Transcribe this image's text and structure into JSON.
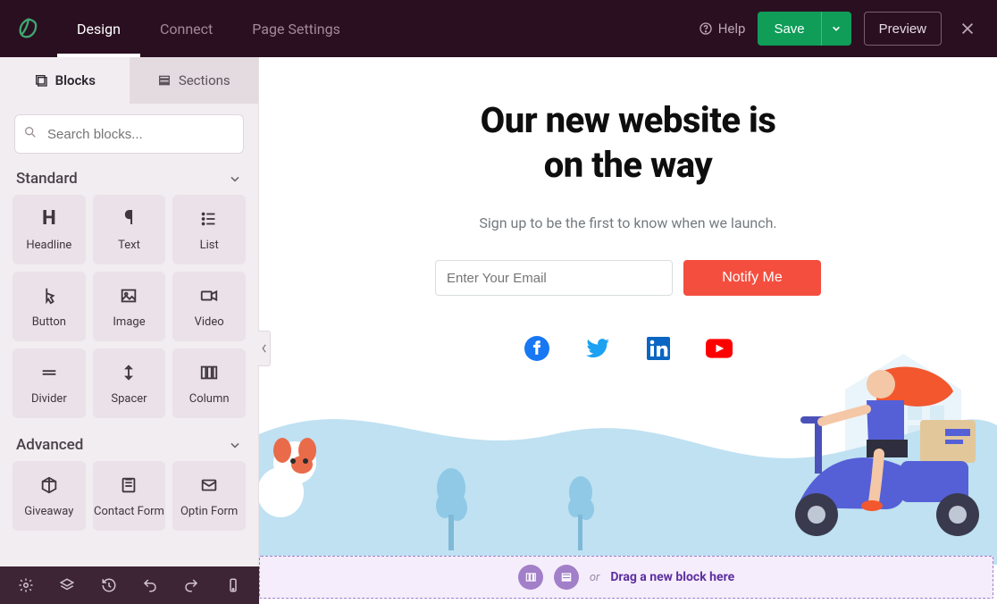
{
  "topbar": {
    "tabs": [
      "Design",
      "Connect",
      "Page Settings"
    ],
    "active_tab": 0,
    "help_label": "Help",
    "save_label": "Save",
    "preview_label": "Preview"
  },
  "sidebar": {
    "tabs": {
      "blocks": "Blocks",
      "sections": "Sections",
      "active": "blocks"
    },
    "search_placeholder": "Search blocks...",
    "groups": [
      {
        "title": "Standard",
        "items": [
          {
            "key": "headline",
            "label": "Headline"
          },
          {
            "key": "text",
            "label": "Text"
          },
          {
            "key": "list",
            "label": "List"
          },
          {
            "key": "button",
            "label": "Button"
          },
          {
            "key": "image",
            "label": "Image"
          },
          {
            "key": "video",
            "label": "Video"
          },
          {
            "key": "divider",
            "label": "Divider"
          },
          {
            "key": "spacer",
            "label": "Spacer"
          },
          {
            "key": "column",
            "label": "Column"
          }
        ]
      },
      {
        "title": "Advanced",
        "items": [
          {
            "key": "giveaway",
            "label": "Giveaway"
          },
          {
            "key": "contact-form",
            "label": "Contact Form"
          },
          {
            "key": "optin-form",
            "label": "Optin Form"
          }
        ]
      }
    ]
  },
  "canvas": {
    "hero_line1": "Our new website is",
    "hero_line2": "on the way",
    "subtitle": "Sign up to be the first to know when we launch.",
    "email_placeholder": "Enter Your Email",
    "cta_label": "Notify Me",
    "socials": [
      "facebook",
      "twitter",
      "linkedin",
      "youtube"
    ]
  },
  "dropzone": {
    "or": "or",
    "message": "Drag a new block here"
  },
  "colors": {
    "accent_green": "#0f9d58",
    "cta_orange": "#f44e3f",
    "wave_blue": "#b9daee",
    "purple": "#7b3fc0"
  }
}
